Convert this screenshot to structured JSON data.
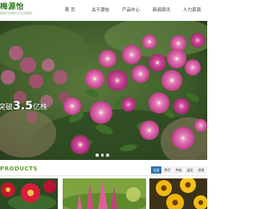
{
  "header": {
    "logo_title": "梅源怡",
    "logo_subtitle": "MEIYUANYI FLOWER"
  },
  "nav": {
    "items": [
      {
        "label": "首 页"
      },
      {
        "label": "关于源怡"
      },
      {
        "label": "产品中心"
      },
      {
        "label": "新闻资讯"
      },
      {
        "label": "人力资源"
      }
    ]
  },
  "banner": {
    "caption_prefix": "突破",
    "caption_number": "3.5",
    "caption_suffix": "亿株",
    "slides_total": 3,
    "active_slide": 1
  },
  "products": {
    "title": "PRODUCTS",
    "tabs": [
      {
        "label": "全部",
        "active": true
      },
      {
        "label": "种子",
        "active": false
      },
      {
        "label": "种苗",
        "active": false
      },
      {
        "label": "盆花",
        "active": false
      },
      {
        "label": "其他",
        "active": false
      }
    ]
  },
  "colors": {
    "brand_green": "#5aa12a",
    "nav_active_blue": "#2f6fb4",
    "petunia_magenta": "#d8479a"
  }
}
